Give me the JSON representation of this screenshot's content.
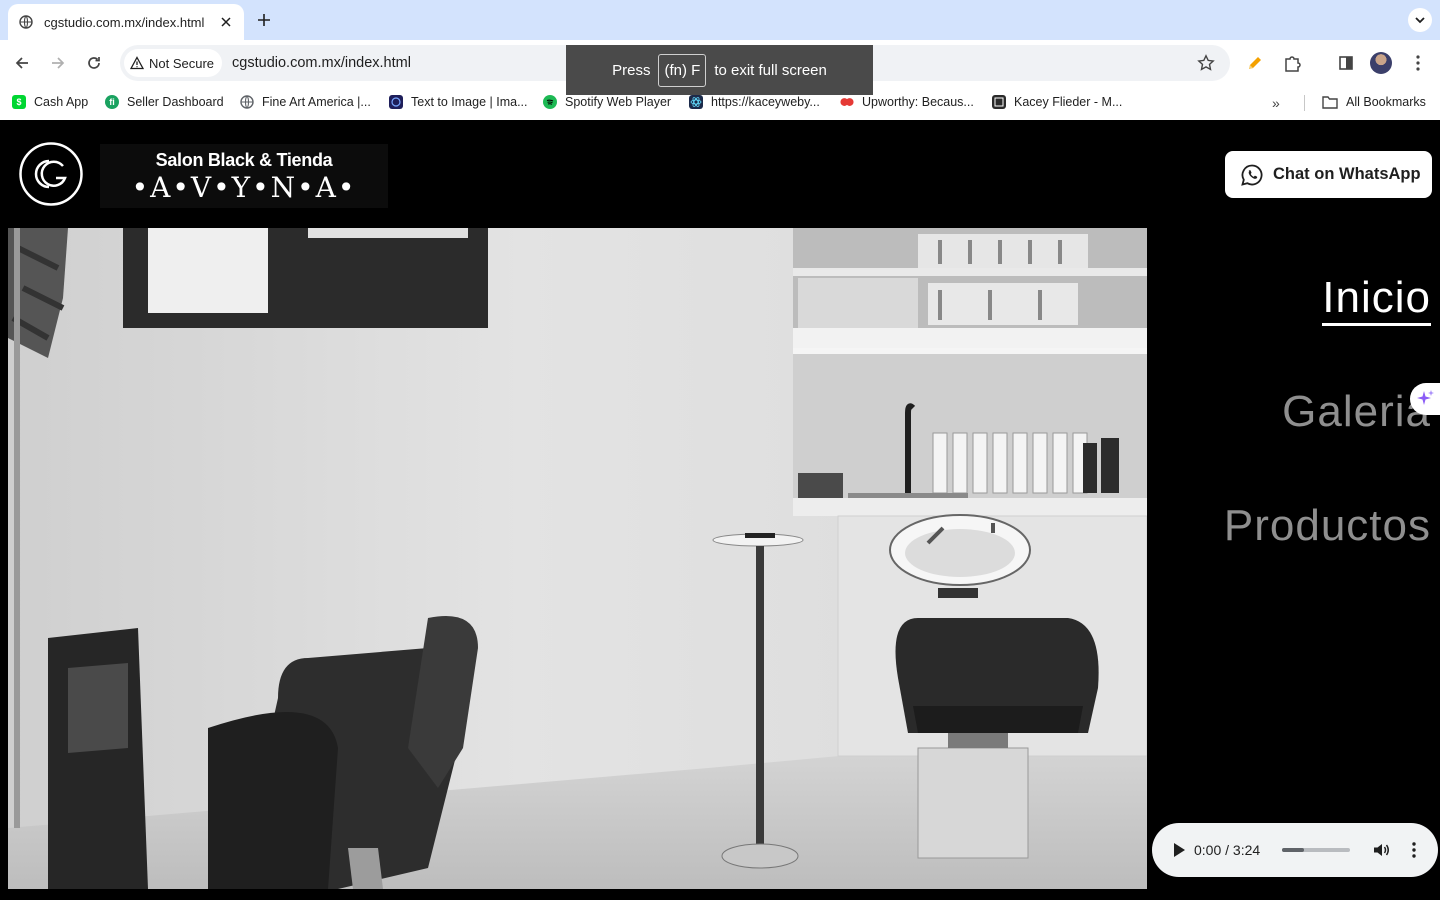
{
  "browser": {
    "tab": {
      "title": "cgstudio.com.mx/index.html"
    },
    "security_label": "Not Secure",
    "url": "cgstudio.com.mx/index.html",
    "fullscreen_toast": {
      "prefix": "Press",
      "key": "(fn) F",
      "suffix": "to exit full screen"
    },
    "bookmarks": [
      {
        "label": "Cash App",
        "color": "#00d632",
        "glyph": "$"
      },
      {
        "label": "Seller Dashboard",
        "color": "#1aa260",
        "glyph": "fi"
      },
      {
        "label": "Fine Art America |...",
        "color": "#5f6368",
        "glyph": ""
      },
      {
        "label": "Text to Image | Ima...",
        "color": "#1e1e5a",
        "glyph": ""
      },
      {
        "label": "Spotify Web Player",
        "color": "#1db954",
        "glyph": ""
      },
      {
        "label": "https://kaceyweby...",
        "color": "#1b2a4a",
        "glyph": ""
      },
      {
        "label": "Upworthy: Becaus...",
        "color": "#e53935",
        "glyph": ""
      },
      {
        "label": "Kacey Flieder - M...",
        "color": "#2a2a2a",
        "glyph": ""
      }
    ],
    "all_bookmarks_label": "All Bookmarks"
  },
  "site": {
    "brand_subtitle": "Salon Black & Tienda",
    "brand_name": "•A•V•Y•N•A•",
    "whatsapp_label": "Chat on WhatsApp",
    "nav": [
      {
        "label": "Inicio",
        "active": true
      },
      {
        "label": "Galeria",
        "active": false
      },
      {
        "label": "Productos",
        "active": false
      }
    ],
    "audio": {
      "time": "0:00 / 3:24",
      "volume": 0.33
    }
  }
}
